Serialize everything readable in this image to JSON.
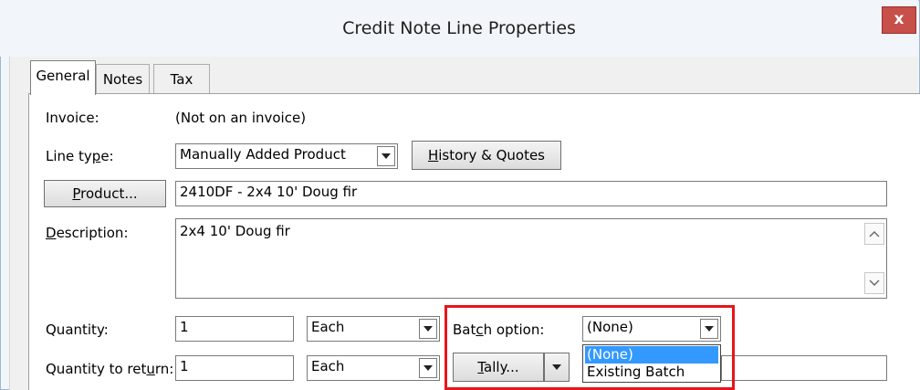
{
  "window": {
    "title": "Credit Note Line Properties",
    "close_label": "x"
  },
  "tabs": [
    {
      "label": "General",
      "active": true
    },
    {
      "label": "Notes",
      "active": false
    },
    {
      "label": "Tax",
      "active": false
    }
  ],
  "form": {
    "invoice_label": "Invoice:",
    "invoice_value": "(Not on an invoice)",
    "line_type_label": "Line type:",
    "line_type_value": "Manually Added Product",
    "history_button": "History & Quotes",
    "product_button": "Product...",
    "product_value": "2410DF - 2x4 10' Doug fir",
    "description_label": "Description:",
    "description_value": "2x4 10' Doug fir",
    "quantity_label": "Quantity:",
    "quantity_value": "1",
    "quantity_unit": "Each",
    "qty_return_label": "Quantity to return:",
    "qty_return_value": "1",
    "qty_return_unit": "Each",
    "batch_option_label": "Batch option:",
    "batch_option_value": "(None)",
    "tally_button": "Tally...",
    "batch_options": [
      "(None)",
      "Existing Batch"
    ]
  },
  "colors": {
    "highlight_border": "#e8151b",
    "selection": "#3399ff",
    "close_button": "#c7504a"
  }
}
